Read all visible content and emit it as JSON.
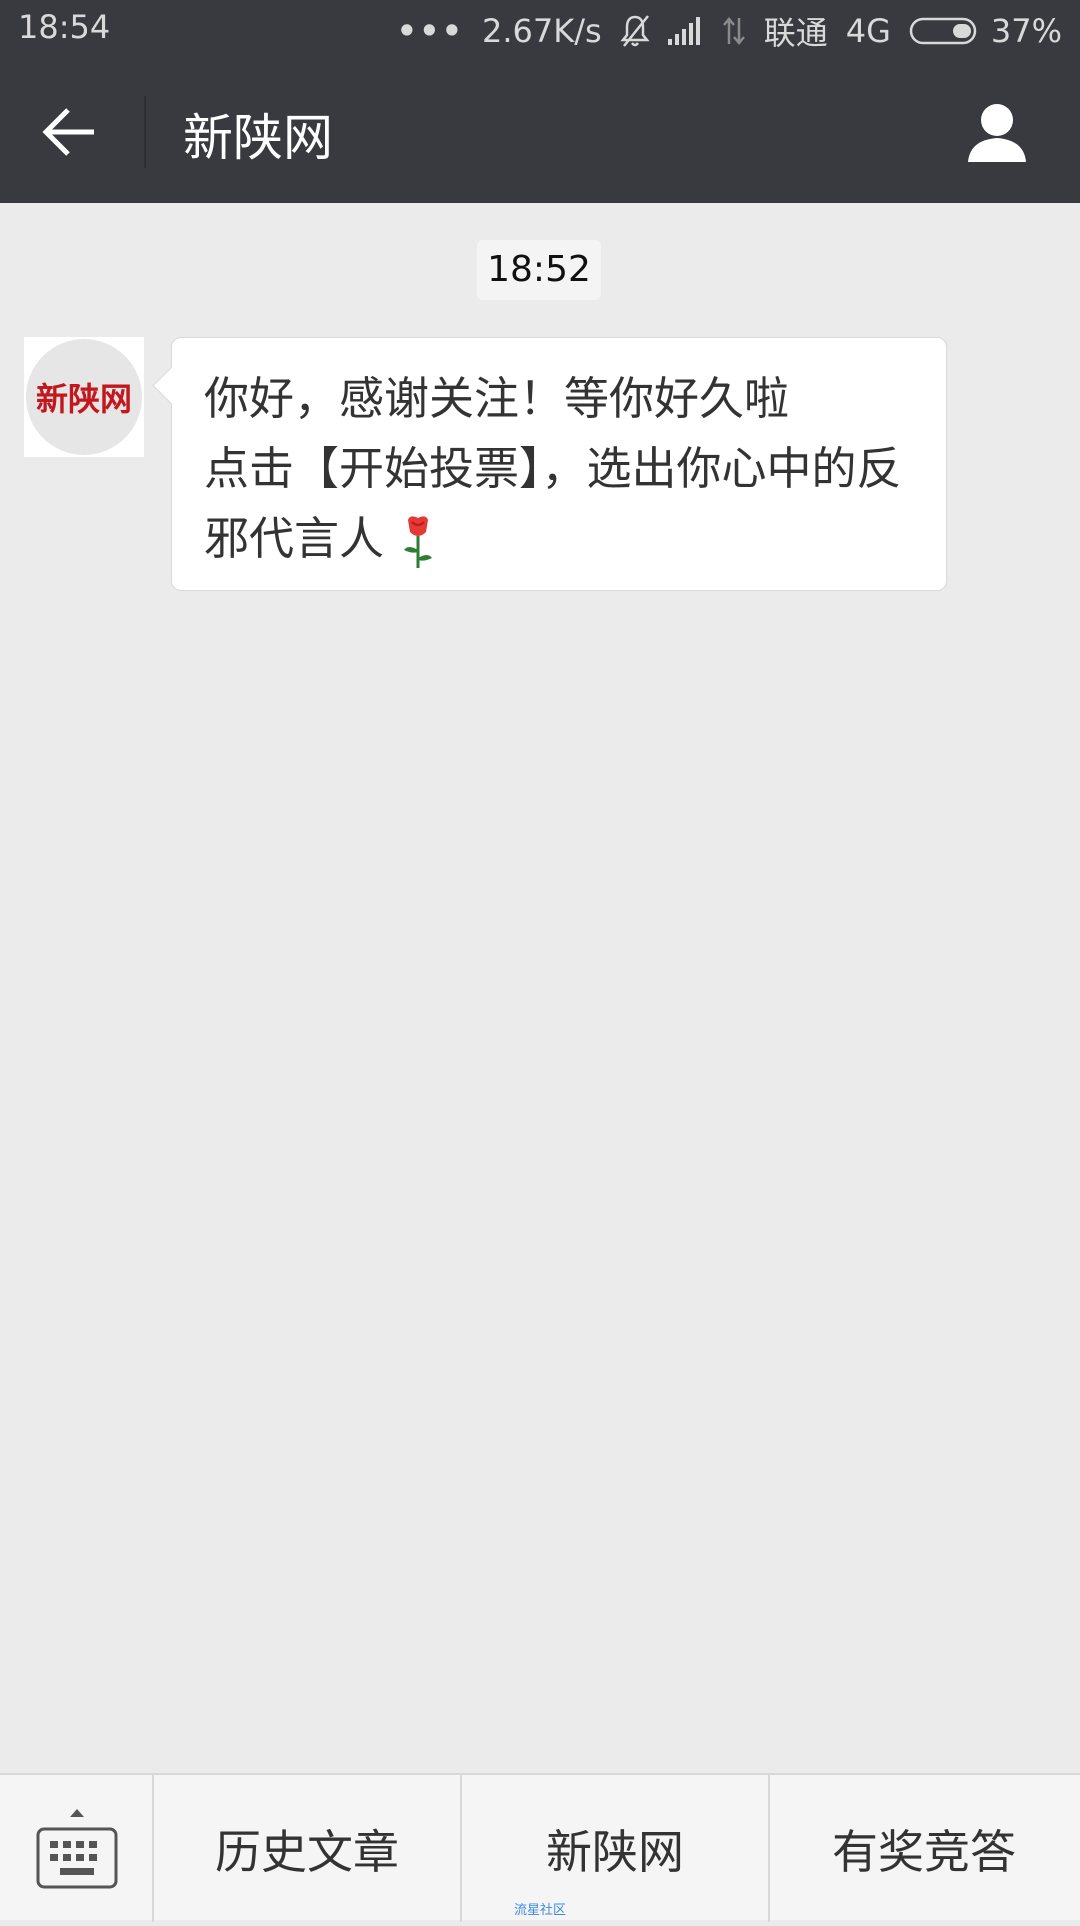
{
  "status_bar": {
    "time": "18:54",
    "dots": "•••",
    "speed": "2.67K/s",
    "carrier": "联通",
    "network": "4G",
    "battery": "37%"
  },
  "header": {
    "title": "新陕网"
  },
  "chat": {
    "timestamp": "18:52",
    "avatar_text": "新陕网",
    "message_line1": "你好，感谢关注！等你好久啦",
    "message_line2": "点击【开始投票】，选出你心中的反",
    "message_line3": "邪代言人"
  },
  "bottom_menu": {
    "item1": "历史文章",
    "item2": "新陕网",
    "item3": "有奖竞答",
    "watermark": "流星社区"
  }
}
